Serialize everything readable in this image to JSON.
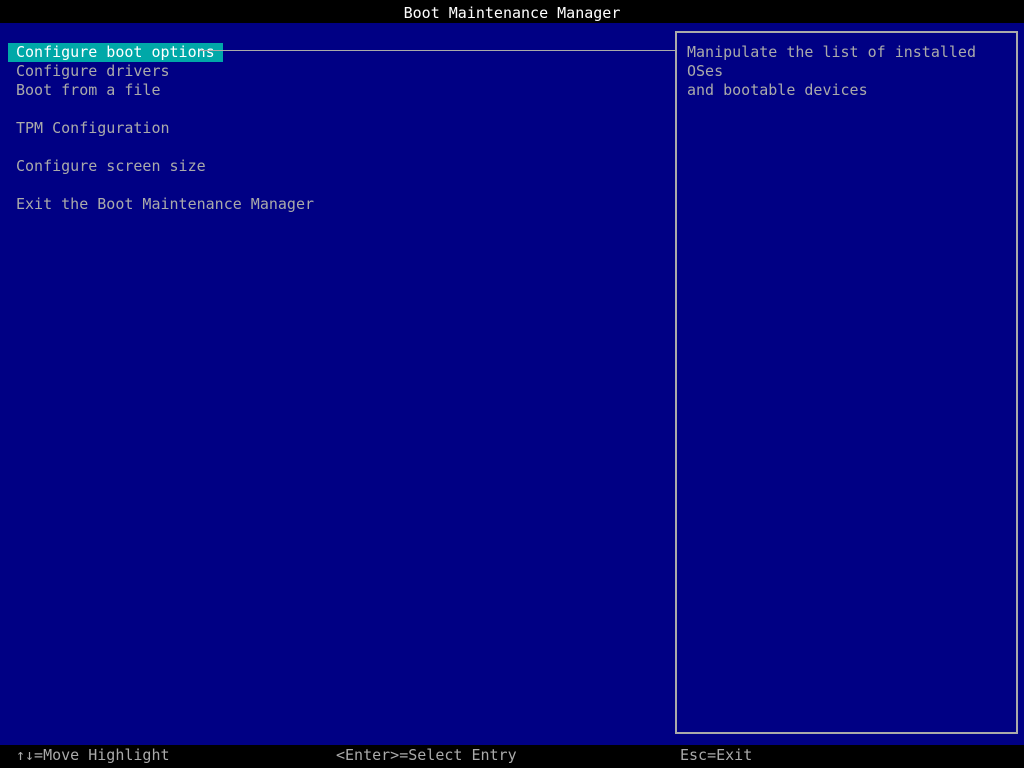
{
  "title": "Boot Maintenance Manager",
  "menu": {
    "items": [
      {
        "label": "Configure boot options",
        "selected": true
      },
      {
        "label": "Configure drivers",
        "selected": false
      },
      {
        "label": "Boot from a file",
        "selected": false
      },
      {
        "label": "TPM Configuration",
        "selected": false
      },
      {
        "label": "Configure screen size",
        "selected": false
      },
      {
        "label": "Exit the Boot Maintenance Manager",
        "selected": false
      }
    ]
  },
  "help": {
    "text": "Manipulate the list of installed OSes\nand bootable devices"
  },
  "footer": {
    "move_hint": "↑↓=Move Highlight",
    "select_hint": "<Enter>=Select Entry",
    "exit_hint": "Esc=Exit"
  },
  "colors": {
    "background": "#000084",
    "bar": "#000000",
    "text": "#aaaaaa",
    "highlight_bg": "#00a8a8",
    "highlight_text": "#ffffff"
  }
}
